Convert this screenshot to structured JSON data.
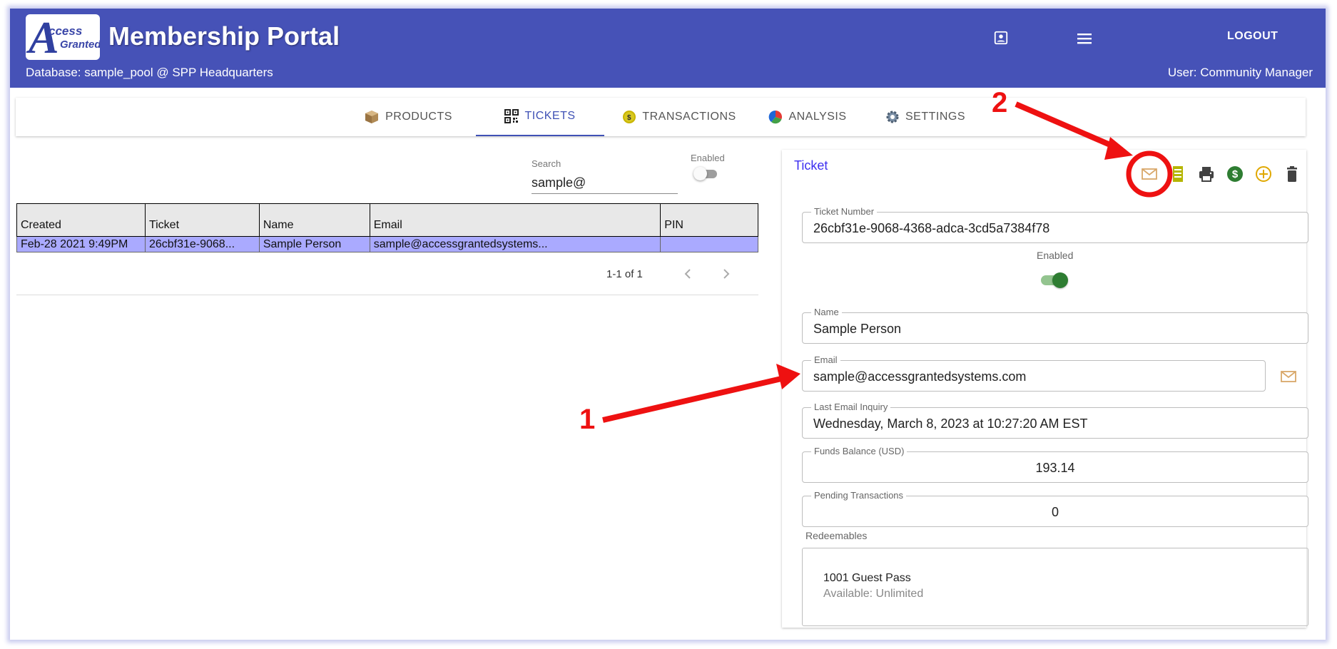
{
  "header": {
    "logo_line1": "ccess",
    "logo_line2": "Granted",
    "logo_letter": "A",
    "title": "Membership Portal",
    "database": "Database: sample_pool @ SPP Headquarters",
    "user": "User: Community Manager",
    "logout_label": "LOGOUT",
    "account_icon": "account-box-icon",
    "menu_icon": "hamburger-menu-icon"
  },
  "tabs": [
    {
      "label": "PRODUCTS",
      "icon": "package-icon",
      "active": false
    },
    {
      "label": "TICKETS",
      "icon": "qr-code-icon",
      "active": true
    },
    {
      "label": "TRANSACTIONS",
      "icon": "coin-icon",
      "active": false
    },
    {
      "label": "ANALYSIS",
      "icon": "pie-chart-icon",
      "active": false
    },
    {
      "label": "SETTINGS",
      "icon": "gear-icon",
      "active": false
    }
  ],
  "search": {
    "label": "Search",
    "value": "sample@"
  },
  "enabled_filter": {
    "label": "Enabled",
    "on": false
  },
  "table": {
    "columns": [
      "Created",
      "Ticket",
      "Name",
      "Email",
      "PIN"
    ],
    "rows": [
      [
        "Feb-28 2021 9:49PM",
        "26cbf31e-9068...",
        "Sample Person",
        "sample@accessgrantedsystems...",
        ""
      ]
    ]
  },
  "pagination": {
    "range": "1-1 of 1"
  },
  "ticket": {
    "title": "Ticket",
    "actions": [
      "email-icon",
      "receipt-icon",
      "print-icon",
      "dollar-icon",
      "add-circle-icon",
      "delete-icon"
    ],
    "ticket_number_label": "Ticket Number",
    "ticket_number": "26cbf31e-9068-4368-adca-3cd5a7384f78",
    "enabled_label": "Enabled",
    "enabled": true,
    "name_label": "Name",
    "name": "Sample Person",
    "email_label": "Email",
    "email": "sample@accessgrantedsystems.com",
    "last_inquiry_label": "Last Email Inquiry",
    "last_inquiry": "Wednesday, March 8, 2023 at 10:27:20 AM EST",
    "funds_label": "Funds Balance (USD)",
    "funds": "193.14",
    "pending_label": "Pending Transactions",
    "pending": "0",
    "redeemables_label": "Redeemables",
    "redeemables": [
      {
        "name": "1001 Guest Pass",
        "available": "Available: Unlimited"
      }
    ]
  },
  "annotations": {
    "marker1": "1",
    "marker2": "2",
    "color": "#ee1111"
  },
  "colors": {
    "header": "#4652b7",
    "active_tab": "#3f51b5",
    "selected_row": "#aaaaff",
    "toggle_on": "#2e7d32",
    "email_icon": "#d9a86a"
  }
}
